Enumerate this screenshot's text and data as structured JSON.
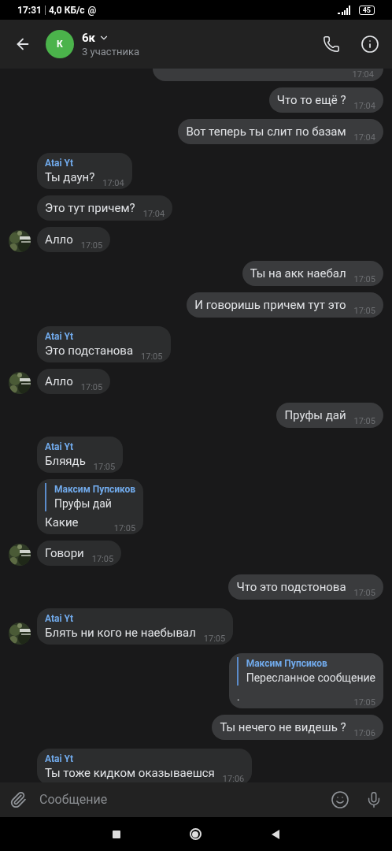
{
  "status_bar": {
    "time": "17:31",
    "speed": "4,0 КБ/с",
    "at": "@",
    "battery": "45"
  },
  "header": {
    "avatar_letter": "К",
    "title": "6к",
    "subtitle": "3 участника"
  },
  "messages": [
    {
      "outgoing": true,
      "kind": "clipped",
      "time": "17:04"
    },
    {
      "outgoing": true,
      "kind": "text",
      "text": "Что то ещё ?",
      "time": "17:04"
    },
    {
      "outgoing": true,
      "kind": "text",
      "text": "Вот теперь ты слит по базам",
      "time": "17:04"
    },
    {
      "outgoing": false,
      "kind": "text",
      "author": "Atai Yt",
      "text": "Ты даун?",
      "time": "17:04",
      "avatar": false
    },
    {
      "outgoing": false,
      "kind": "text",
      "text": "Это тут причем?",
      "time": "17:04",
      "avatar": false
    },
    {
      "outgoing": false,
      "kind": "text",
      "text": "Алло",
      "time": "17:05",
      "avatar": true
    },
    {
      "outgoing": true,
      "kind": "text",
      "text": "Ты на акк наебал",
      "time": "17:05"
    },
    {
      "outgoing": true,
      "kind": "text",
      "text": "И говоришь причем тут это",
      "time": "17:05"
    },
    {
      "outgoing": false,
      "kind": "text",
      "author": "Atai Yt",
      "text": "Это подстанова",
      "time": "17:05",
      "avatar": false
    },
    {
      "outgoing": false,
      "kind": "text",
      "text": "Алло",
      "time": "17:05",
      "avatar": true
    },
    {
      "outgoing": true,
      "kind": "text",
      "text": "Пруфы дай",
      "time": "17:05"
    },
    {
      "outgoing": false,
      "kind": "text",
      "author": "Atai Yt",
      "text": "Бляядь",
      "time": "17:05",
      "avatar": false
    },
    {
      "outgoing": false,
      "kind": "reply",
      "quote": {
        "author": "Максим Пупсиков",
        "text": "Пруфы дай"
      },
      "text": "Какие",
      "time": "17:05",
      "avatar": false
    },
    {
      "outgoing": false,
      "kind": "text",
      "text": "Говори",
      "time": "17:05",
      "avatar": true
    },
    {
      "outgoing": true,
      "kind": "text",
      "text": "Что это подстонова",
      "time": "17:05"
    },
    {
      "outgoing": false,
      "kind": "text",
      "author": "Atai Yt",
      "text": "Блять ни кого не наебывал",
      "time": "17:05",
      "avatar": true
    },
    {
      "outgoing": true,
      "kind": "forward",
      "quote": {
        "author": "Максим Пупсиков",
        "text": "Пересланное сообщение"
      },
      "text": ".",
      "time": "17:05"
    },
    {
      "outgoing": true,
      "kind": "text",
      "text": "Ты нечего не видешь ?",
      "time": "17:06"
    },
    {
      "outgoing": false,
      "kind": "text",
      "author": "Atai Yt",
      "text": "Ты тоже кидком оказываешся",
      "time": "17:06",
      "avatar": false
    }
  ],
  "composer": {
    "placeholder": "Сообщение"
  }
}
